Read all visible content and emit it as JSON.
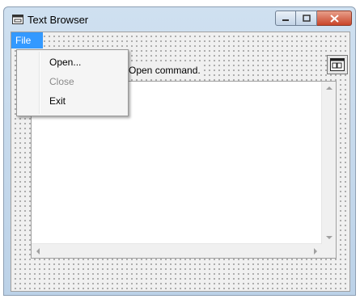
{
  "window": {
    "title": "Text Browser"
  },
  "menubar": {
    "file_label": "File"
  },
  "file_menu": {
    "items": [
      "Open...",
      "Close",
      "Exit"
    ]
  },
  "form": {
    "info_text": "Open command."
  },
  "icons": {
    "title": "app-window-icon",
    "toolbar": "common-dialog-control-icon"
  },
  "colors": {
    "menu_highlight": "#3399ff",
    "close_button": "#c9452a"
  }
}
